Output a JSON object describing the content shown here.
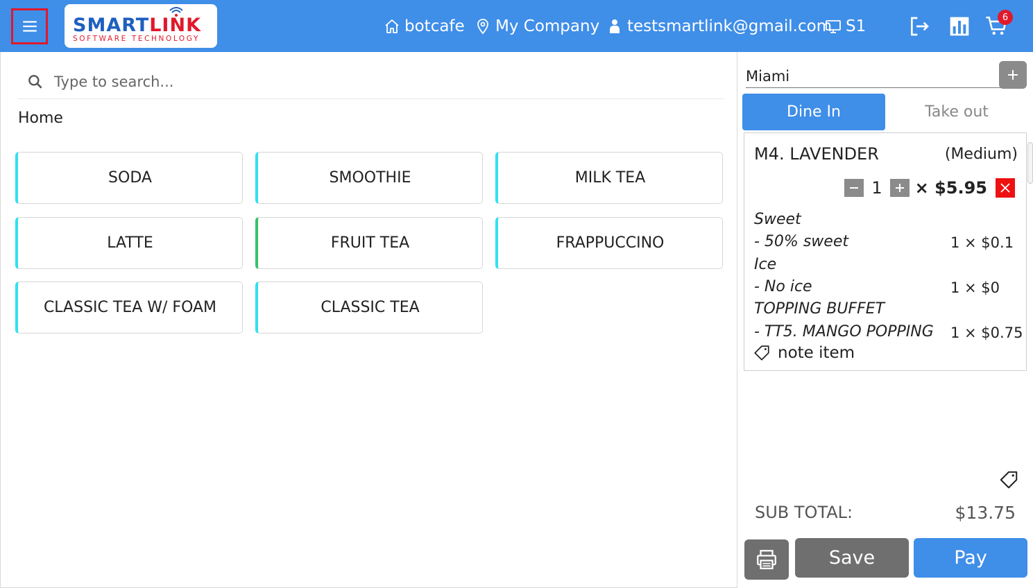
{
  "header": {
    "logo": {
      "word_blue": "SMART",
      "word_red": "LINK",
      "tagline": "SOFTWARE TECHNOLOGY"
    },
    "store": "botcafe",
    "company": "My Company",
    "user_email": "testsmartlink@gmail.com",
    "station": "S1",
    "cart_count": "6",
    "color_primary": "#3f8ee8"
  },
  "search": {
    "placeholder": "Type to search...",
    "value": ""
  },
  "breadcrumb": "Home",
  "categories": [
    {
      "label": "SODA"
    },
    {
      "label": "SMOOTHIE"
    },
    {
      "label": "MILK TEA"
    },
    {
      "label": "LATTE"
    },
    {
      "label": "FRUIT TEA"
    },
    {
      "label": "FRAPPUCCINO"
    },
    {
      "label": "CLASSIC TEA W/ FOAM"
    },
    {
      "label": "CLASSIC TEA"
    }
  ],
  "order": {
    "customer": "Miami",
    "tabs": [
      {
        "label": "Dine In",
        "active": true
      },
      {
        "label": "Take out",
        "active": false
      }
    ],
    "item": {
      "name": "M4. LAVENDER",
      "size": "(Medium)",
      "quantity": "1",
      "price_text": "× $5.95",
      "modifiers": [
        {
          "text": "Sweet"
        },
        {
          "text": "- 50% sweet",
          "price": "1 × $0.1"
        },
        {
          "text": "Ice"
        },
        {
          "text": "- No ice",
          "price": "1 × $0"
        },
        {
          "text": "TOPPING BUFFET"
        },
        {
          "text": "- TT5. MANGO POPPING",
          "price": "1 × $0.75"
        }
      ],
      "note_label": "note item"
    },
    "subtotal_label": "SUB TOTAL:",
    "subtotal_value": "$13.75",
    "save_label": "Save",
    "pay_label": "Pay"
  }
}
